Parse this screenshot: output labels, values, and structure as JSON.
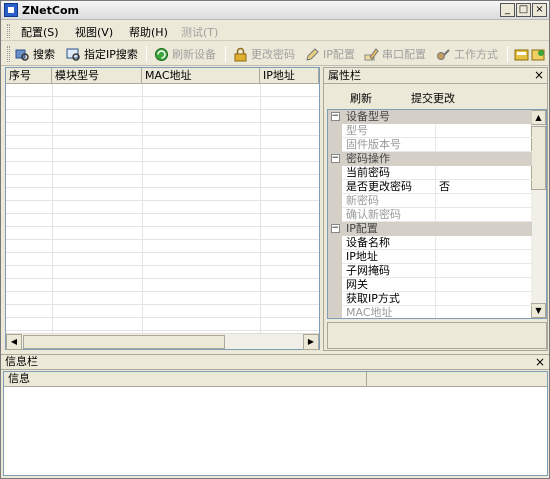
{
  "window": {
    "title": "ZNetCom",
    "minimize": "_",
    "maximize": "□",
    "close": "×"
  },
  "menu": [
    {
      "label": "配置(S)",
      "enabled": true
    },
    {
      "label": "视图(V)",
      "enabled": true
    },
    {
      "label": "帮助(H)",
      "enabled": true
    },
    {
      "label": "测试(T)",
      "enabled": false
    }
  ],
  "toolbar": {
    "search": "搜索",
    "ip_search": "指定IP搜索",
    "refresh_device": "刷新设备",
    "change_password": "更改密码",
    "ip_config": "IP配置",
    "serial_config": "串口配置",
    "work_mode": "工作方式"
  },
  "device_list": {
    "columns": [
      "序号",
      "模块型号",
      "MAC地址",
      "IP地址"
    ],
    "rows": []
  },
  "properties": {
    "title": "属性栏",
    "close": "×",
    "refresh": "刷新",
    "submit": "提交更改",
    "rows": [
      {
        "kind": "category",
        "sign": "−",
        "name": "设备型号"
      },
      {
        "kind": "prop",
        "name": "型号",
        "value": "",
        "dim": true
      },
      {
        "kind": "prop",
        "name": "固件版本号",
        "value": "",
        "dim": true
      },
      {
        "kind": "category",
        "sign": "−",
        "name": "密码操作"
      },
      {
        "kind": "prop",
        "name": "当前密码",
        "value": "",
        "dim": false
      },
      {
        "kind": "prop",
        "name": "是否更改密码",
        "value": "否",
        "dim": false
      },
      {
        "kind": "prop",
        "name": "新密码",
        "value": "",
        "dim": true
      },
      {
        "kind": "prop",
        "name": "确认新密码",
        "value": "",
        "dim": true
      },
      {
        "kind": "category",
        "sign": "−",
        "name": "IP配置"
      },
      {
        "kind": "prop",
        "name": "设备名称",
        "value": "",
        "dim": false
      },
      {
        "kind": "prop",
        "name": "IP地址",
        "value": "",
        "dim": false
      },
      {
        "kind": "prop",
        "name": "子网掩码",
        "value": "",
        "dim": false
      },
      {
        "kind": "prop",
        "name": "网关",
        "value": "",
        "dim": false
      },
      {
        "kind": "prop",
        "name": "获取IP方式",
        "value": "",
        "dim": false
      },
      {
        "kind": "prop",
        "name": "MAC地址",
        "value": "",
        "dim": true
      }
    ]
  },
  "info": {
    "title": "信息栏",
    "close": "×",
    "columns": [
      "信息",
      ""
    ]
  },
  "colors": {
    "face": "#ece9d8",
    "border": "#7f9db9",
    "category": "#d4d0c8"
  }
}
